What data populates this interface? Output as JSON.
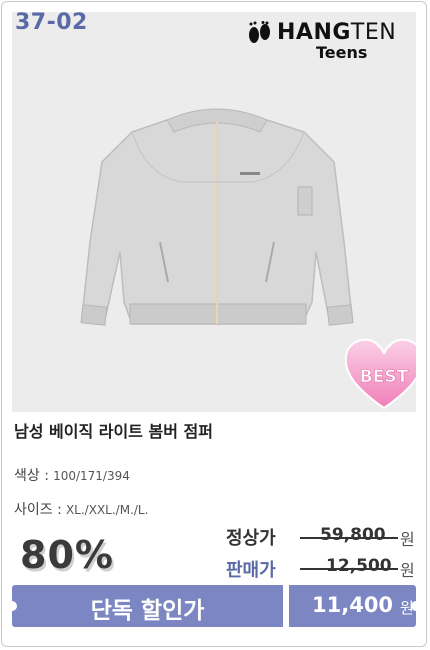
{
  "code": "37-02",
  "brand": {
    "name_bold": "HANG",
    "name_thin": "TEN",
    "sub": "Teens"
  },
  "badge": "BEST",
  "product": {
    "title": "남성 베이직 라이트 봄버 점퍼",
    "color_label": "색상 :",
    "color_value": "100/171/394",
    "size_label": "사이즈 :",
    "size_value": "XL./XXL./M./L."
  },
  "pricing": {
    "discount": "80%",
    "regular_label": "정상가",
    "regular_price": "59,800",
    "sale_label": "판매가",
    "sale_price": "12,500",
    "currency": "원",
    "promo_label": "단독 할인가",
    "final_price": "11,400",
    "final_currency": "원"
  },
  "colors": {
    "accent": "#7b86c2",
    "code": "#5a6aa6",
    "badge": "#f497c6"
  }
}
